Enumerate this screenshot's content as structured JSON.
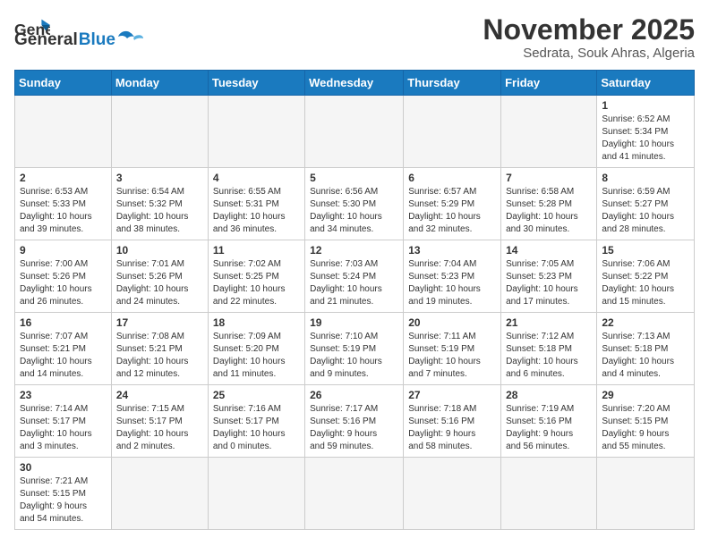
{
  "logo": {
    "text_general": "General",
    "text_blue": "Blue"
  },
  "header": {
    "month": "November 2025",
    "location": "Sedrata, Souk Ahras, Algeria"
  },
  "weekdays": [
    "Sunday",
    "Monday",
    "Tuesday",
    "Wednesday",
    "Thursday",
    "Friday",
    "Saturday"
  ],
  "weeks": [
    [
      {
        "day": "",
        "info": ""
      },
      {
        "day": "",
        "info": ""
      },
      {
        "day": "",
        "info": ""
      },
      {
        "day": "",
        "info": ""
      },
      {
        "day": "",
        "info": ""
      },
      {
        "day": "",
        "info": ""
      },
      {
        "day": "1",
        "info": "Sunrise: 6:52 AM\nSunset: 5:34 PM\nDaylight: 10 hours\nand 41 minutes."
      }
    ],
    [
      {
        "day": "2",
        "info": "Sunrise: 6:53 AM\nSunset: 5:33 PM\nDaylight: 10 hours\nand 39 minutes."
      },
      {
        "day": "3",
        "info": "Sunrise: 6:54 AM\nSunset: 5:32 PM\nDaylight: 10 hours\nand 38 minutes."
      },
      {
        "day": "4",
        "info": "Sunrise: 6:55 AM\nSunset: 5:31 PM\nDaylight: 10 hours\nand 36 minutes."
      },
      {
        "day": "5",
        "info": "Sunrise: 6:56 AM\nSunset: 5:30 PM\nDaylight: 10 hours\nand 34 minutes."
      },
      {
        "day": "6",
        "info": "Sunrise: 6:57 AM\nSunset: 5:29 PM\nDaylight: 10 hours\nand 32 minutes."
      },
      {
        "day": "7",
        "info": "Sunrise: 6:58 AM\nSunset: 5:28 PM\nDaylight: 10 hours\nand 30 minutes."
      },
      {
        "day": "8",
        "info": "Sunrise: 6:59 AM\nSunset: 5:27 PM\nDaylight: 10 hours\nand 28 minutes."
      }
    ],
    [
      {
        "day": "9",
        "info": "Sunrise: 7:00 AM\nSunset: 5:26 PM\nDaylight: 10 hours\nand 26 minutes."
      },
      {
        "day": "10",
        "info": "Sunrise: 7:01 AM\nSunset: 5:26 PM\nDaylight: 10 hours\nand 24 minutes."
      },
      {
        "day": "11",
        "info": "Sunrise: 7:02 AM\nSunset: 5:25 PM\nDaylight: 10 hours\nand 22 minutes."
      },
      {
        "day": "12",
        "info": "Sunrise: 7:03 AM\nSunset: 5:24 PM\nDaylight: 10 hours\nand 21 minutes."
      },
      {
        "day": "13",
        "info": "Sunrise: 7:04 AM\nSunset: 5:23 PM\nDaylight: 10 hours\nand 19 minutes."
      },
      {
        "day": "14",
        "info": "Sunrise: 7:05 AM\nSunset: 5:23 PM\nDaylight: 10 hours\nand 17 minutes."
      },
      {
        "day": "15",
        "info": "Sunrise: 7:06 AM\nSunset: 5:22 PM\nDaylight: 10 hours\nand 15 minutes."
      }
    ],
    [
      {
        "day": "16",
        "info": "Sunrise: 7:07 AM\nSunset: 5:21 PM\nDaylight: 10 hours\nand 14 minutes."
      },
      {
        "day": "17",
        "info": "Sunrise: 7:08 AM\nSunset: 5:21 PM\nDaylight: 10 hours\nand 12 minutes."
      },
      {
        "day": "18",
        "info": "Sunrise: 7:09 AM\nSunset: 5:20 PM\nDaylight: 10 hours\nand 11 minutes."
      },
      {
        "day": "19",
        "info": "Sunrise: 7:10 AM\nSunset: 5:19 PM\nDaylight: 10 hours\nand 9 minutes."
      },
      {
        "day": "20",
        "info": "Sunrise: 7:11 AM\nSunset: 5:19 PM\nDaylight: 10 hours\nand 7 minutes."
      },
      {
        "day": "21",
        "info": "Sunrise: 7:12 AM\nSunset: 5:18 PM\nDaylight: 10 hours\nand 6 minutes."
      },
      {
        "day": "22",
        "info": "Sunrise: 7:13 AM\nSunset: 5:18 PM\nDaylight: 10 hours\nand 4 minutes."
      }
    ],
    [
      {
        "day": "23",
        "info": "Sunrise: 7:14 AM\nSunset: 5:17 PM\nDaylight: 10 hours\nand 3 minutes."
      },
      {
        "day": "24",
        "info": "Sunrise: 7:15 AM\nSunset: 5:17 PM\nDaylight: 10 hours\nand 2 minutes."
      },
      {
        "day": "25",
        "info": "Sunrise: 7:16 AM\nSunset: 5:17 PM\nDaylight: 10 hours\nand 0 minutes."
      },
      {
        "day": "26",
        "info": "Sunrise: 7:17 AM\nSunset: 5:16 PM\nDaylight: 9 hours\nand 59 minutes."
      },
      {
        "day": "27",
        "info": "Sunrise: 7:18 AM\nSunset: 5:16 PM\nDaylight: 9 hours\nand 58 minutes."
      },
      {
        "day": "28",
        "info": "Sunrise: 7:19 AM\nSunset: 5:16 PM\nDaylight: 9 hours\nand 56 minutes."
      },
      {
        "day": "29",
        "info": "Sunrise: 7:20 AM\nSunset: 5:15 PM\nDaylight: 9 hours\nand 55 minutes."
      }
    ],
    [
      {
        "day": "30",
        "info": "Sunrise: 7:21 AM\nSunset: 5:15 PM\nDaylight: 9 hours\nand 54 minutes."
      },
      {
        "day": "",
        "info": ""
      },
      {
        "day": "",
        "info": ""
      },
      {
        "day": "",
        "info": ""
      },
      {
        "day": "",
        "info": ""
      },
      {
        "day": "",
        "info": ""
      },
      {
        "day": "",
        "info": ""
      }
    ]
  ]
}
